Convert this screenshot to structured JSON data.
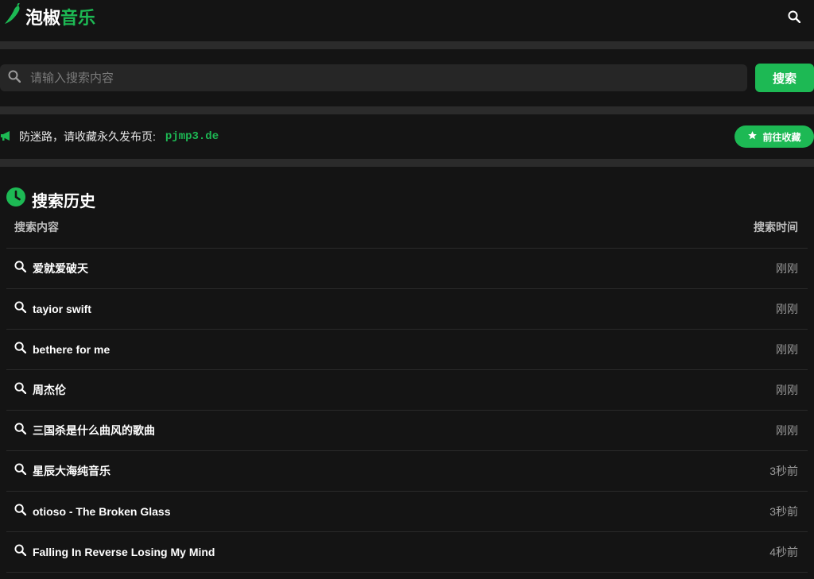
{
  "header": {
    "logo_part1": "泡椒",
    "logo_part2": "音乐",
    "search_icon": "search-icon"
  },
  "search": {
    "placeholder": "请输入搜索内容",
    "button_label": "搜索"
  },
  "notice": {
    "text": "防迷路，请收藏永久发布页:",
    "url": "pjmp3.de",
    "button_label": "前往收藏"
  },
  "history": {
    "title": "搜索历史",
    "col_query": "搜索内容",
    "col_time": "搜索时间",
    "rows": [
      {
        "query": "爱就爱破天",
        "time": "刚刚"
      },
      {
        "query": "tayior swift",
        "time": "刚刚"
      },
      {
        "query": "bethere for me",
        "time": "刚刚"
      },
      {
        "query": "周杰伦",
        "time": "刚刚"
      },
      {
        "query": "三国杀是什么曲风的歌曲",
        "time": "刚刚"
      },
      {
        "query": "星辰大海纯音乐",
        "time": "3秒前"
      },
      {
        "query": "otioso - The Broken Glass",
        "time": "3秒前"
      },
      {
        "query": "Falling In Reverse Losing My Mind",
        "time": "4秒前"
      }
    ]
  },
  "colors": {
    "accent": "#1db954",
    "background": "#141414",
    "band": "#2b2b2b"
  }
}
